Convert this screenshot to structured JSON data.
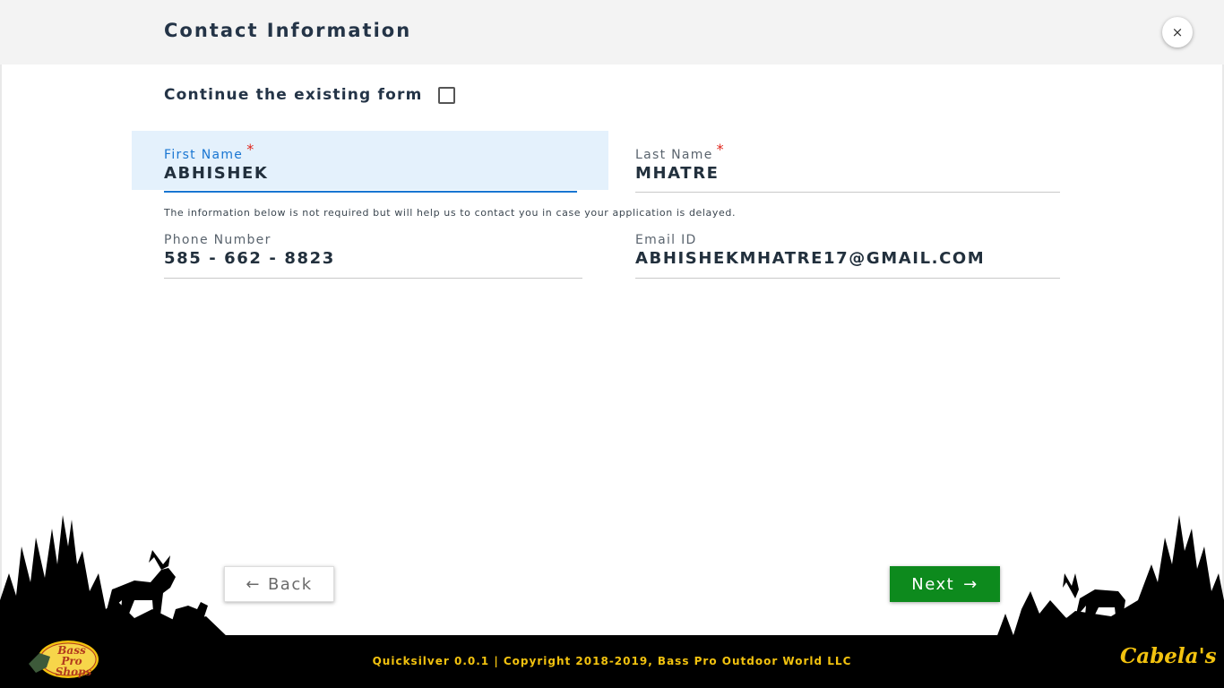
{
  "header": {
    "title": "Contact Information",
    "close_symbol": "×"
  },
  "continue_form": {
    "label": "Continue the existing form",
    "checked": false
  },
  "fields": {
    "first_name": {
      "label": "First Name",
      "required_mark": "*",
      "value": "ABHISHEK"
    },
    "last_name": {
      "label": "Last Name",
      "required_mark": "*",
      "value": "MHATRE"
    },
    "phone": {
      "label": "Phone Number",
      "value": "585 - 662 - 8823"
    },
    "email": {
      "label": "Email ID",
      "value": "ABHISHEKMHATRE17@GMAIL.COM"
    }
  },
  "info_text": "The information below is not required but will help us to contact you in case your application is delayed.",
  "nav": {
    "back_label": "Back",
    "back_icon": "←",
    "next_label": "Next",
    "next_icon": "→"
  },
  "footer": {
    "copyright": "Quicksilver 0.0.1 | Copyright 2018-2019, Bass Pro Outdoor World LLC",
    "left_logo": "Bass Pro Shops",
    "right_logo": "Cabela's"
  },
  "colors": {
    "accent": "#1976d2",
    "next": "#0d8a1d",
    "required": "#e0251b",
    "footer_text": "#f2c20f"
  }
}
